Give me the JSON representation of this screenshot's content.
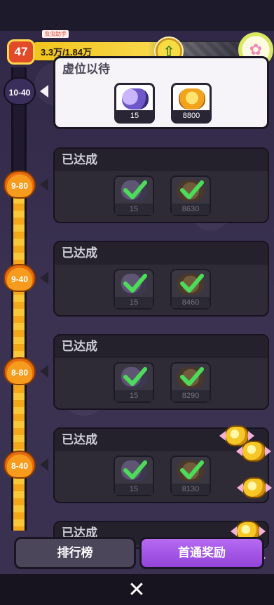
{
  "header": {
    "level": "47",
    "xp_text": "3.3万/1.84万",
    "tag": "虫虫助手"
  },
  "nodes": [
    {
      "label": "10-40",
      "state": "locked"
    },
    {
      "label": "9-80",
      "state": "done"
    },
    {
      "label": "9-40",
      "state": "done"
    },
    {
      "label": "8-80",
      "state": "done"
    },
    {
      "label": "8-40",
      "state": "done"
    }
  ],
  "cards": [
    {
      "title": "虚位以待",
      "state": "active",
      "rewards": [
        {
          "icon": "purple-orb",
          "count": "15"
        },
        {
          "icon": "gold-coins",
          "count": "8800"
        }
      ]
    },
    {
      "title": "已达成",
      "state": "done",
      "rewards": [
        {
          "icon": "purple-orb",
          "count": "15"
        },
        {
          "icon": "gold-coins",
          "count": "8630"
        }
      ]
    },
    {
      "title": "已达成",
      "state": "done",
      "rewards": [
        {
          "icon": "purple-orb",
          "count": "15"
        },
        {
          "icon": "gold-coins",
          "count": "8460"
        }
      ]
    },
    {
      "title": "已达成",
      "state": "done",
      "rewards": [
        {
          "icon": "purple-orb",
          "count": "15"
        },
        {
          "icon": "gold-coins",
          "count": "8290"
        }
      ]
    },
    {
      "title": "已达成",
      "state": "done",
      "rewards": [
        {
          "icon": "purple-orb",
          "count": "15"
        },
        {
          "icon": "gold-coins",
          "count": "8130"
        }
      ]
    },
    {
      "title": "已达成",
      "state": "done",
      "rewards": []
    }
  ],
  "buttons": {
    "rank": "排行榜",
    "first_clear": "首通奖励",
    "close": "✕"
  },
  "colors": {
    "accent_purple": "#9a4ee0",
    "gold": "#f3a81a",
    "check_green": "#4bdc5a"
  }
}
